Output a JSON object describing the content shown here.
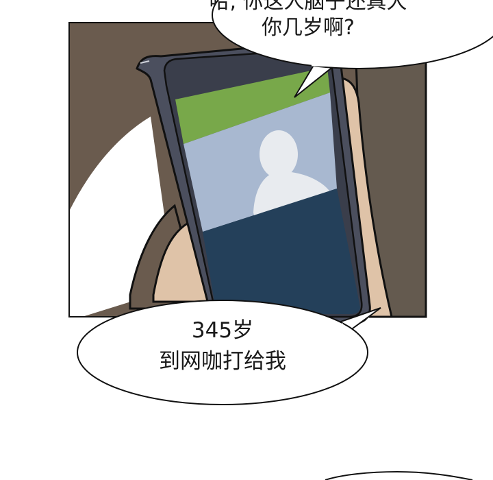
{
  "speech_top": {
    "line1": "哈, 你这人脑子还真大",
    "line2": "你几岁啊?"
  },
  "speech_bottom": {
    "line1": "345岁",
    "line2": "到网咖打给我"
  },
  "colors": {
    "panel_bg": "#6a5b4e",
    "phone_body": "#4b4f5e",
    "screen_green": "#78a84a",
    "screen_blue": "#a8b8d0",
    "screen_navy": "#24405a",
    "skin": "#dfc3a8",
    "sleeve": "#645a4f",
    "avatar": "#e8ebef"
  }
}
